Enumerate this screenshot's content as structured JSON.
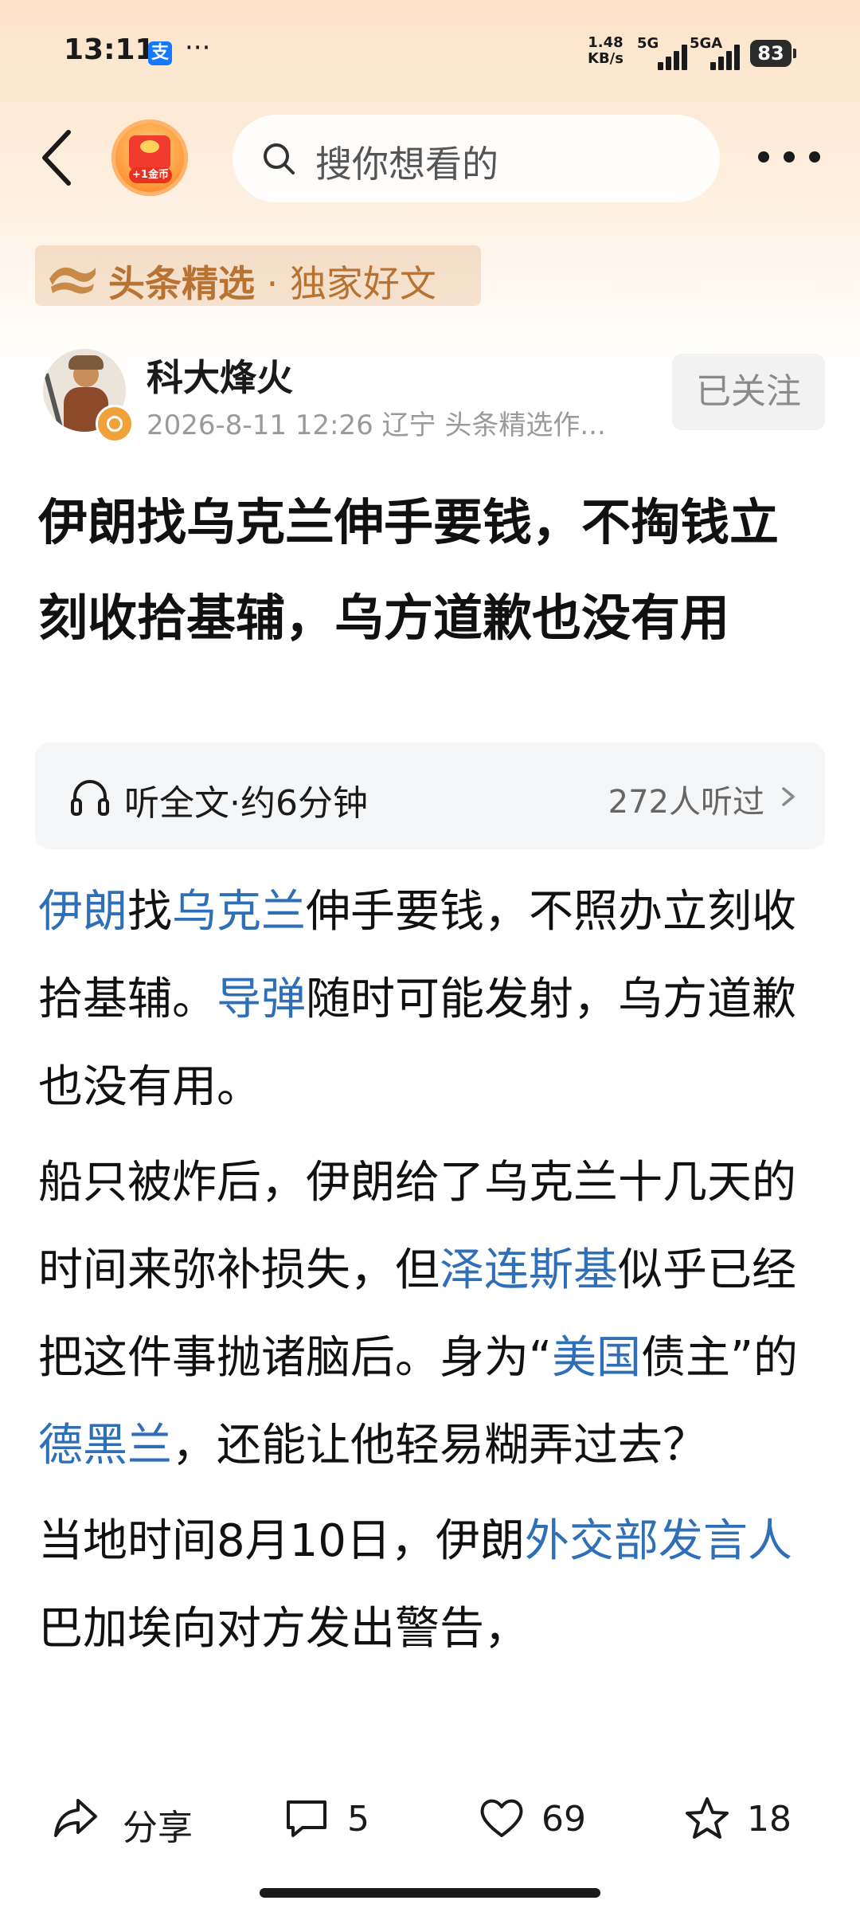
{
  "status_bar": {
    "time": "13:11",
    "alipay_glyph": "支",
    "more": "···",
    "speed_value": "1.48",
    "speed_unit": "KB/s",
    "net1": "5G",
    "net2": "5GA",
    "battery": "83"
  },
  "header": {
    "coin_label": "+1金币",
    "search_placeholder": "搜你想看的"
  },
  "channel": {
    "name": "头条精选",
    "separator": " · ",
    "tagline": "独家好文"
  },
  "author": {
    "name": "科大烽火",
    "meta": "2026-8-11  12:26  辽宁  头条精选作...",
    "follow_label": "已关注"
  },
  "article": {
    "title": "伊朗找乌克兰伸手要钱，不掏钱立刻收拾基辅，乌方道歉也没有用",
    "listen_label": "听全文·约6分钟",
    "listen_count": "272人听过",
    "p1": {
      "link1": "伊朗",
      "t1": "找",
      "link2": "乌克兰",
      "t2": "伸手要钱，不照办立刻收拾基辅。",
      "link3": "导弹",
      "t3": "随时可能发射，乌方道歉也没有用。"
    },
    "p2": {
      "t1": "船只被炸后，伊朗给了乌克兰十几天的时间来弥补损失，但",
      "link1": "泽连斯基",
      "t2": "似乎已经把这件事抛诸脑后。身为“",
      "link2": "美国",
      "t3": "债主”的",
      "link3": "德黑兰",
      "t4": "，还能让他轻易糊弄过去？"
    },
    "p3": {
      "t1": "当地时间8月10日，伊朗",
      "link1": "外交部发言人",
      "t2": "巴加埃向对方发出警告，"
    }
  },
  "actions": {
    "share_label": "分享",
    "comment_count": "5",
    "like_count": "69",
    "favorite_count": "18"
  },
  "colors": {
    "link": "#2f6fb8",
    "channel_gold": "#b87333",
    "header_gradient_top": "#fbe3c8"
  }
}
